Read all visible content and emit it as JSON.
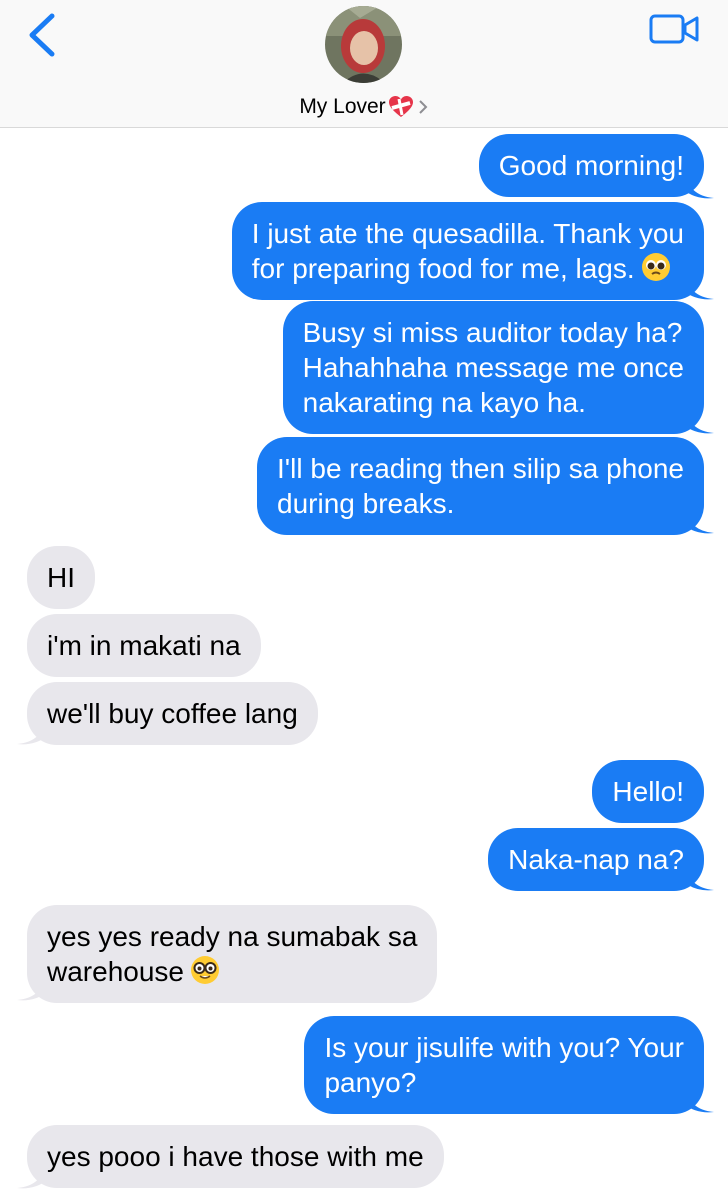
{
  "contact": {
    "name": "My Lover"
  },
  "icons": {
    "back": "chevron-left-icon",
    "video": "video-camera-icon",
    "heart": "mending-heart-icon",
    "disclosure": "chevron-right-icon",
    "pleading": "pleading-face-icon",
    "nerd": "nerd-face-icon"
  },
  "colors": {
    "sent": "#1a7cf4",
    "received": "#e8e7ec",
    "accent": "#1a7cf4"
  },
  "messages": [
    {
      "dir": "sent",
      "lines": [
        "Good morning!"
      ]
    },
    {
      "dir": "sent",
      "lines": [
        "I just ate the quesadilla. Thank you",
        "for preparing food for me, lags."
      ]
    },
    {
      "dir": "sent",
      "lines": [
        "Busy si miss auditor today ha?",
        "Hahahhaha message me once",
        "nakarating na kayo ha."
      ]
    },
    {
      "dir": "sent",
      "lines": [
        "I'll be reading then silip sa phone",
        "during breaks."
      ]
    },
    {
      "dir": "received",
      "lines": [
        "HI"
      ]
    },
    {
      "dir": "received",
      "lines": [
        "i'm in makati na"
      ]
    },
    {
      "dir": "received",
      "lines": [
        "we'll buy coffee lang"
      ]
    },
    {
      "dir": "sent",
      "lines": [
        "Hello!"
      ]
    },
    {
      "dir": "sent",
      "lines": [
        "Naka-nap na?"
      ]
    },
    {
      "dir": "received",
      "lines": [
        "yes yes ready na sumabak sa",
        "warehouse"
      ]
    },
    {
      "dir": "sent",
      "lines": [
        "Is your jisulife with you? Your",
        "panyo?"
      ]
    },
    {
      "dir": "received",
      "lines": [
        "yes pooo i have those with me"
      ]
    }
  ]
}
